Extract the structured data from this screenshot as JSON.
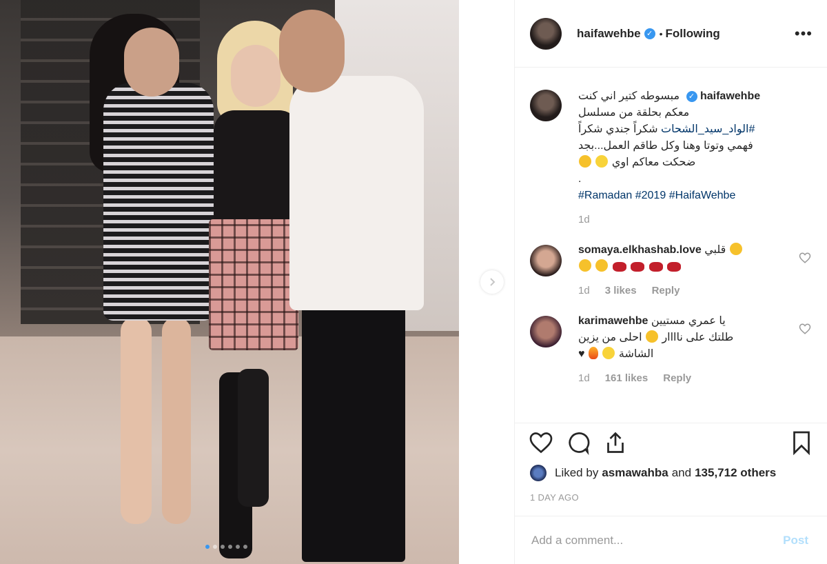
{
  "post": {
    "username": "haifawehbe",
    "separator": "•",
    "follow_status": "Following",
    "more_label": "•••",
    "caption": {
      "line1": "مبسوطه كتير اني كنت",
      "line2": "معكم بحلقة من مسلسل",
      "hashtag_series": "#الواد_سيد_الشحات",
      "line3_rest": " شكراً جندي شكراً",
      "line4": "فهمي وتوتا وهنا وكل طاقم العمل...بجد",
      "line5": "ضحكت معاكم اوي",
      "dot": ".",
      "hashtags": [
        "#Ramadan",
        "#2019",
        "#HaifaWehbe"
      ],
      "age": "1d"
    },
    "comments": [
      {
        "username": "somaya.elkhashab.love",
        "text": "قلبي",
        "age": "1d",
        "likes": "3 likes",
        "reply": "Reply"
      },
      {
        "username": "karimawehbe",
        "line1": "يا عمري مستيين",
        "line2": "طلتك على ناااار",
        "line2b": "احلى من يزين",
        "line3": "الشاشة",
        "heart_char": "♥",
        "age": "1d",
        "likes": "161 likes",
        "reply": "Reply"
      }
    ],
    "liked_by_prefix": "Liked by ",
    "liked_by_user": "asmawahba",
    "liked_by_middle": " and ",
    "liked_by_count": "135,712 others",
    "time_ago": "1 DAY AGO",
    "comment_placeholder": "Add a comment...",
    "post_button": "Post",
    "carousel": {
      "total": 6,
      "active": 1
    }
  },
  "colors": {
    "link": "#003569",
    "verified": "#3897f0",
    "muted": "#999999",
    "post_disabled": "#b2dffc"
  },
  "icons": [
    "verified-icon",
    "more-icon",
    "chevron-right-icon",
    "heart-icon",
    "comment-icon",
    "share-icon",
    "bookmark-icon"
  ]
}
